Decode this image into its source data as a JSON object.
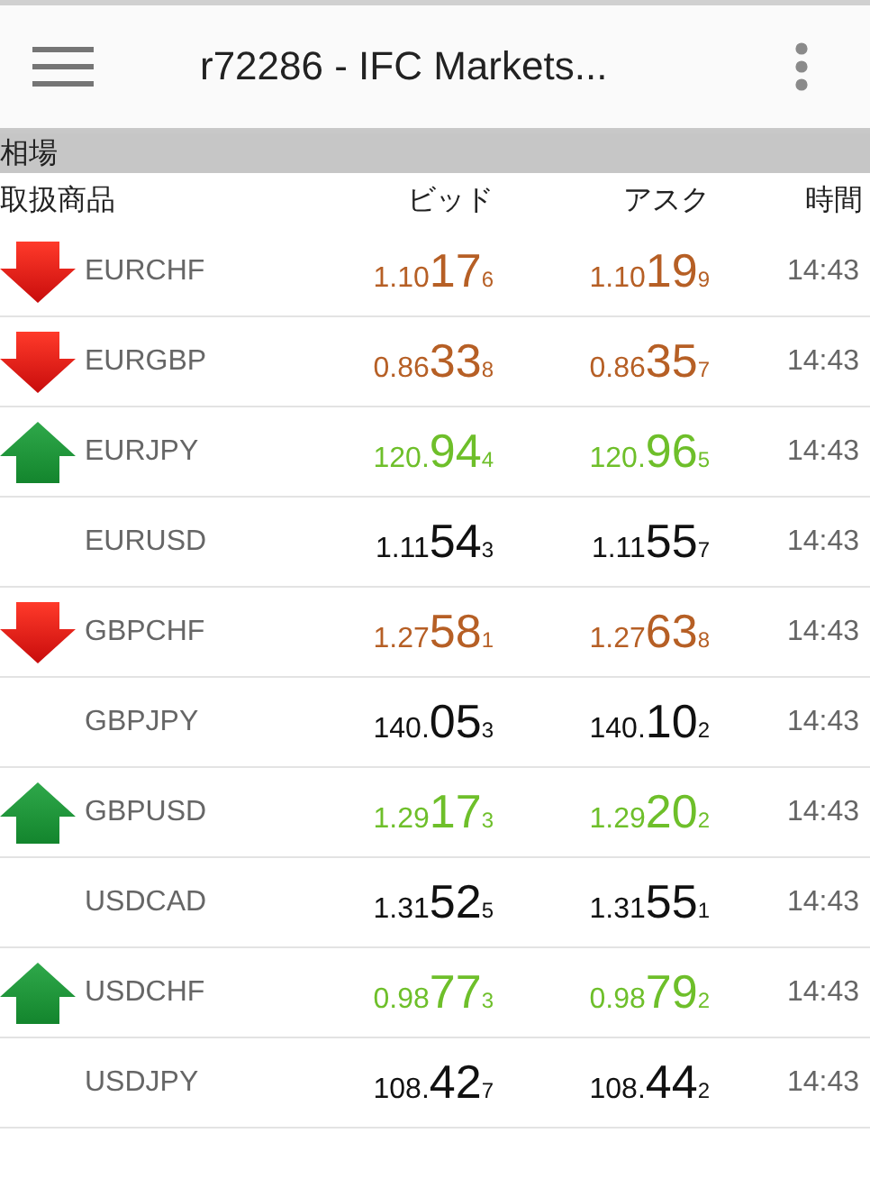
{
  "app_bar": {
    "title": "r72286 - IFC Markets..."
  },
  "section": {
    "title": "相場"
  },
  "columns": [
    "取扱商品",
    "ビッド",
    "アスク",
    "時間"
  ],
  "rows": [
    {
      "kind": "down",
      "symbol": "EURCHF",
      "bid": [
        "1.10",
        "17",
        "6"
      ],
      "ask": [
        "1.10",
        "19",
        "9"
      ],
      "time": "14:43"
    },
    {
      "kind": "down",
      "symbol": "EURGBP",
      "bid": [
        "0.86",
        "33",
        "8"
      ],
      "ask": [
        "0.86",
        "35",
        "7"
      ],
      "time": "14:43"
    },
    {
      "kind": "up",
      "symbol": "EURJPY",
      "bid": [
        "120.",
        "94",
        "4"
      ],
      "ask": [
        "120.",
        "96",
        "5"
      ],
      "time": "14:43"
    },
    {
      "kind": "flat",
      "symbol": "EURUSD",
      "bid": [
        "1.11",
        "54",
        "3"
      ],
      "ask": [
        "1.11",
        "55",
        "7"
      ],
      "time": "14:43"
    },
    {
      "kind": "down",
      "symbol": "GBPCHF",
      "bid": [
        "1.27",
        "58",
        "1"
      ],
      "ask": [
        "1.27",
        "63",
        "8"
      ],
      "time": "14:43"
    },
    {
      "kind": "flat",
      "symbol": "GBPJPY",
      "bid": [
        "140.",
        "05",
        "3"
      ],
      "ask": [
        "140.",
        "10",
        "2"
      ],
      "time": "14:43"
    },
    {
      "kind": "up",
      "symbol": "GBPUSD",
      "bid": [
        "1.29",
        "17",
        "3"
      ],
      "ask": [
        "1.29",
        "20",
        "2"
      ],
      "time": "14:43"
    },
    {
      "kind": "flat",
      "symbol": "USDCAD",
      "bid": [
        "1.31",
        "52",
        "5"
      ],
      "ask": [
        "1.31",
        "55",
        "1"
      ],
      "time": "14:43"
    },
    {
      "kind": "up",
      "symbol": "USDCHF",
      "bid": [
        "0.98",
        "77",
        "3"
      ],
      "ask": [
        "0.98",
        "79",
        "2"
      ],
      "time": "14:43"
    },
    {
      "kind": "flat",
      "symbol": "USDJPY",
      "bid": [
        "108.",
        "42",
        "7"
      ],
      "ask": [
        "108.",
        "44",
        "2"
      ],
      "time": "14:43"
    }
  ]
}
